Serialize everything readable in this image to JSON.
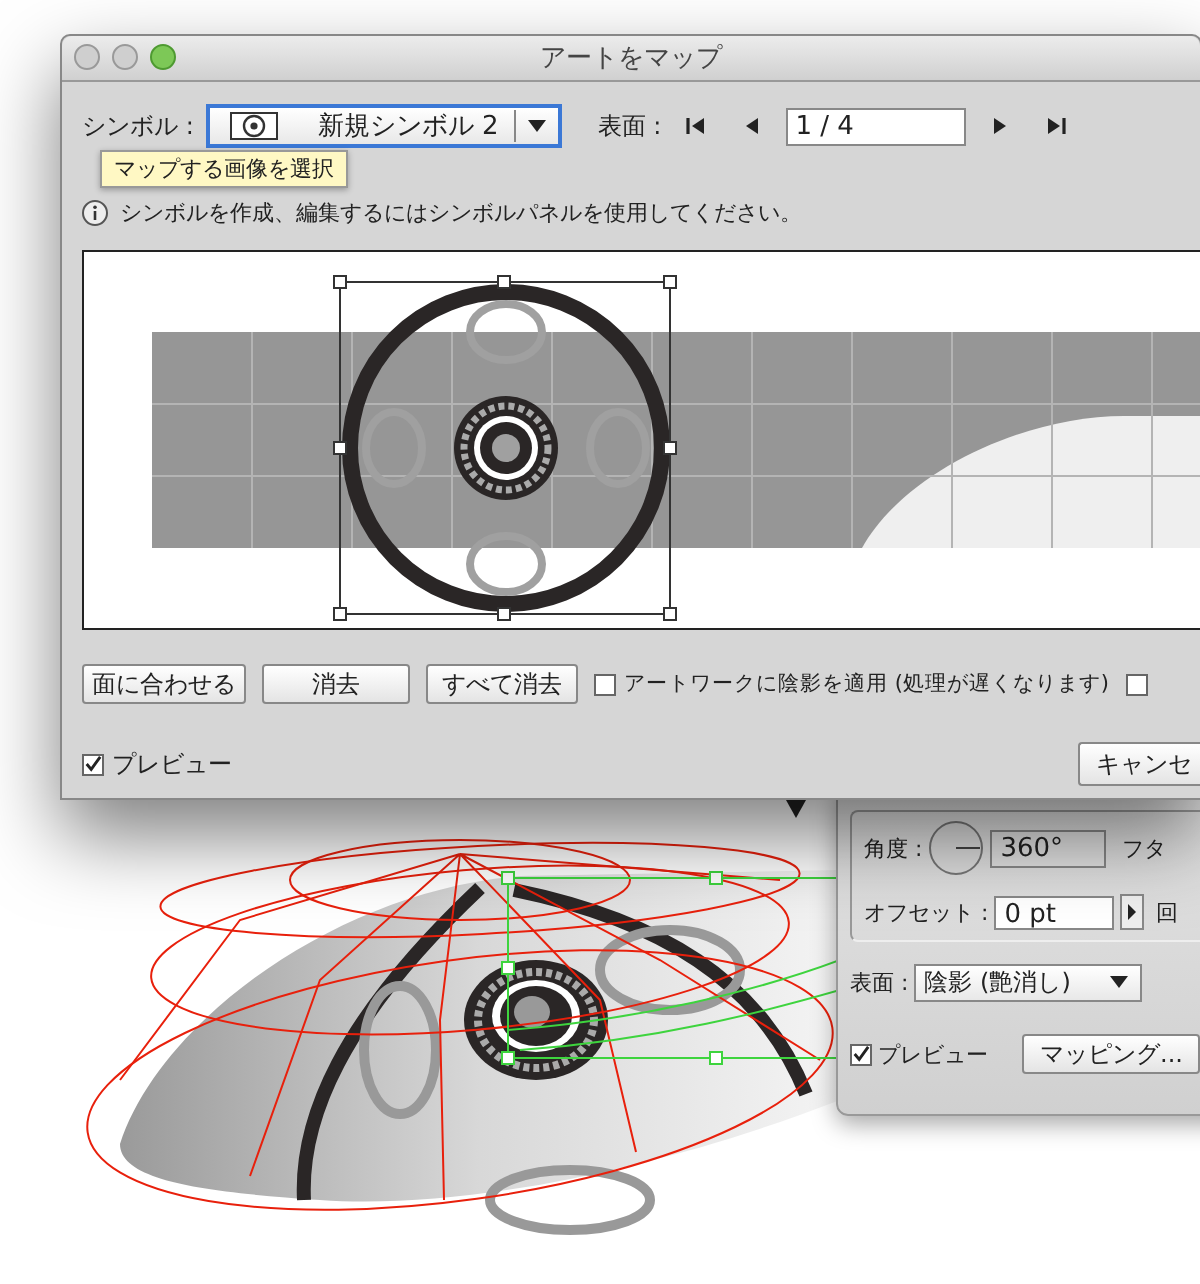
{
  "map_art_dialog": {
    "title": "アートをマップ",
    "symbol_label": "シンボル :",
    "symbol_dropdown": {
      "value": "新規シンボル 2"
    },
    "surface_label": "表面 :",
    "surface_field": {
      "value": "1 / 4"
    },
    "tooltip": "マップする画像を選択",
    "info_text": "シンボルを作成、編集するにはシンボルパネルを使用してください。",
    "buttons": [
      "面に合わせる",
      "消去",
      "すべて消去"
    ],
    "checkboxes": [
      {
        "label": "アートワークに陰影を適用 (処理が遅くなります)",
        "checked": false
      },
      {
        "checked": false
      }
    ],
    "preview": {
      "label": "プレビュー",
      "checked": true
    },
    "cancel_button": "キャンセ"
  },
  "options_panel": {
    "angle_label": "角度 :",
    "angle_value": "360°",
    "cap_label": "フタ",
    "offset_label": "オフセット :",
    "offset_value": "0 pt",
    "cut_label": "回",
    "surface_label": "表面 :",
    "surface_dropdown": {
      "value": "陰影 (艶消し)"
    },
    "preview": {
      "label": "プレビュー",
      "checked": true
    },
    "mapping_button": "マッピング..."
  }
}
